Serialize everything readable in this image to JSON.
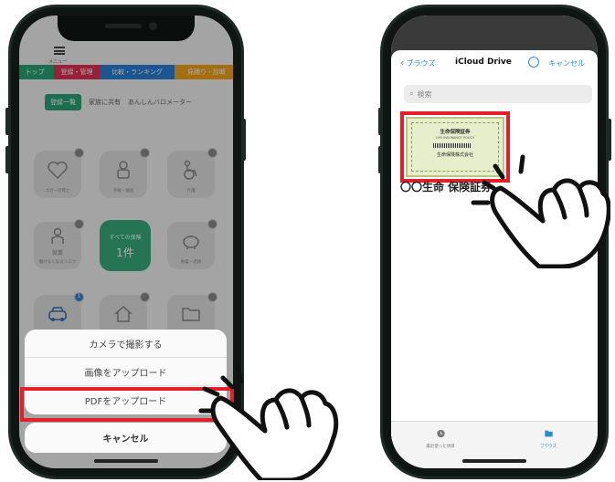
{
  "left_phone": {
    "menu_label": "メニュー",
    "nav_tabs": [
      {
        "label": "トップ",
        "color": "#2aa473"
      },
      {
        "label": "登録・管理",
        "color": "#e03053"
      },
      {
        "label": "比較・ランキング",
        "color": "#2a7fd4"
      },
      {
        "label": "見積り・診断",
        "color": "#f0a418"
      }
    ],
    "sub_tabs": [
      {
        "label": "登録一覧",
        "active": true
      },
      {
        "label": "家族に共有",
        "active": false
      },
      {
        "label": "あんしんバロメーター",
        "active": false
      }
    ],
    "tiles": [
      {
        "label": "ゴガーの死亡",
        "icon": "heart-icon"
      },
      {
        "label": "手術・検査",
        "icon": "patient-icon"
      },
      {
        "label": "介護",
        "icon": "wheelchair-icon"
      },
      {
        "label": "働けなくなるリスク",
        "icon": "worker-icon",
        "sub": "就業"
      },
      {
        "label": "貯蓄・老後",
        "icon": "piggy-bank-icon"
      },
      {
        "label": "",
        "icon": "car-icon",
        "badge": "1"
      },
      {
        "label": "",
        "icon": "house-icon"
      },
      {
        "label": "",
        "icon": "folder-icon"
      }
    ],
    "center_tile": {
      "title": "すべての保険",
      "count": "1件"
    },
    "sheet_options": [
      "カメラで撮影する",
      "画像をアップロード",
      "PDFをアップロード"
    ],
    "cancel_label": "キャンセル"
  },
  "right_phone": {
    "back_label": "ブラウズ",
    "title": "iCloud Drive",
    "more_label": "···",
    "cancel_label": "キャンセル",
    "search_placeholder": "検索",
    "file": {
      "name": "〇〇生命 保険証券",
      "cert_title": "生命保険証券",
      "cert_sub": "LIFE INSURANCE POLICY",
      "cert_company": "生命保険株式会社"
    },
    "tabs": [
      {
        "label": "最近使った項目",
        "icon": "clock-icon",
        "active": false
      },
      {
        "label": "ブラウズ",
        "icon": "folder-icon",
        "active": true
      }
    ]
  },
  "colors": {
    "highlight": "#e3202a",
    "accent_green": "#2aa473",
    "ios_blue": "#2a8bd6"
  }
}
